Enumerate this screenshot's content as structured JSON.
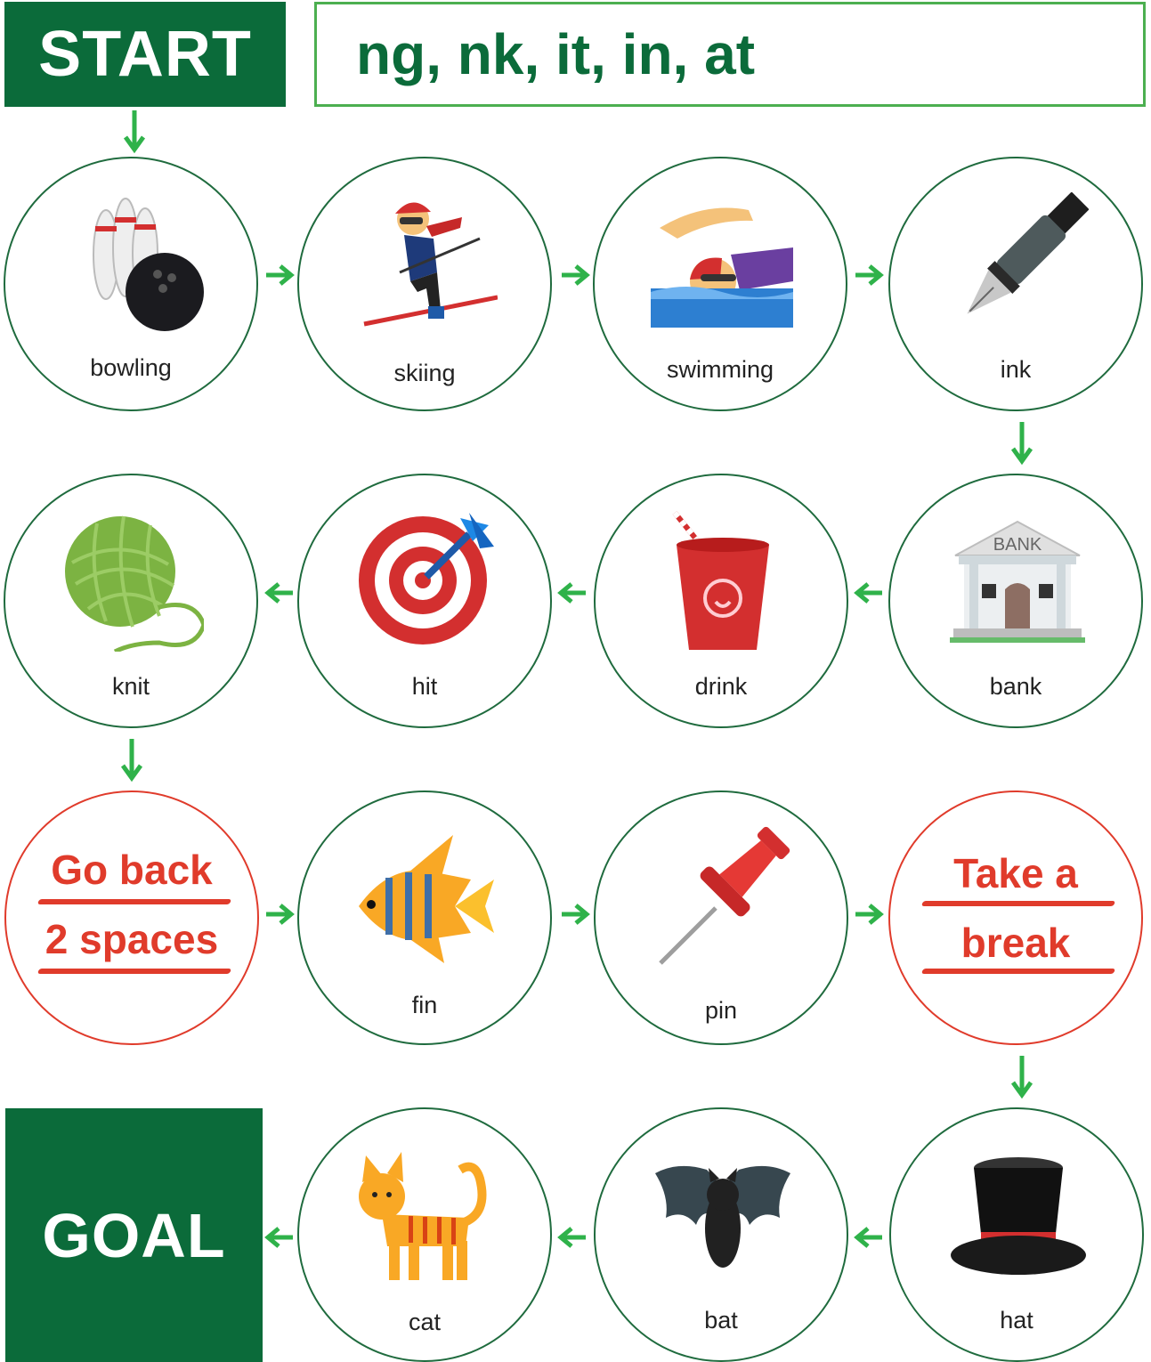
{
  "header": {
    "start_label": "START",
    "title": "ng, nk, it, in, at",
    "goal_label": "GOAL"
  },
  "spaces": [
    {
      "label": "bowling",
      "icon": "bowling-icon"
    },
    {
      "label": "skiing",
      "icon": "skier-icon"
    },
    {
      "label": "swimming",
      "icon": "swimmer-icon"
    },
    {
      "label": "ink",
      "icon": "fountain-pen-icon"
    },
    {
      "label": "bank",
      "icon": "bank-icon",
      "sign": "BANK"
    },
    {
      "label": "drink",
      "icon": "cup-icon"
    },
    {
      "label": "hit",
      "icon": "target-icon"
    },
    {
      "label": "knit",
      "icon": "yarn-ball-icon"
    },
    {
      "special_line1": "Go back",
      "special_line2": "2 spaces"
    },
    {
      "label": "fin",
      "icon": "fish-icon"
    },
    {
      "label": "pin",
      "icon": "pushpin-icon"
    },
    {
      "special_line1": "Take a",
      "special_line2": "break"
    },
    {
      "label": "hat",
      "icon": "top-hat-icon"
    },
    {
      "label": "bat",
      "icon": "bat-icon"
    },
    {
      "label": "cat",
      "icon": "cat-icon"
    }
  ],
  "colors": {
    "dark_green": "#0b6b3a",
    "arrow_green": "#2fb24a",
    "warning_red": "#e03b2b"
  }
}
